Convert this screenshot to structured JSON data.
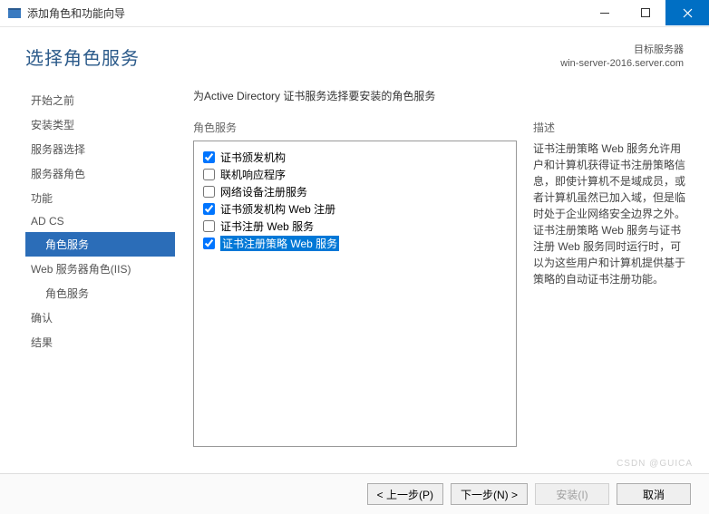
{
  "window": {
    "title": "添加角色和功能向导"
  },
  "header": {
    "heading": "选择角色服务",
    "target_label": "目标服务器",
    "target_value": "win-server-2016.server.com"
  },
  "sidebar": {
    "items": [
      {
        "label": "开始之前",
        "indent": false,
        "selected": false
      },
      {
        "label": "安装类型",
        "indent": false,
        "selected": false
      },
      {
        "label": "服务器选择",
        "indent": false,
        "selected": false
      },
      {
        "label": "服务器角色",
        "indent": false,
        "selected": false
      },
      {
        "label": "功能",
        "indent": false,
        "selected": false
      },
      {
        "label": "AD CS",
        "indent": false,
        "selected": false
      },
      {
        "label": "角色服务",
        "indent": true,
        "selected": true
      },
      {
        "label": "Web 服务器角色(IIS)",
        "indent": false,
        "selected": false
      },
      {
        "label": "角色服务",
        "indent": true,
        "selected": false
      },
      {
        "label": "确认",
        "indent": false,
        "selected": false
      },
      {
        "label": "结果",
        "indent": false,
        "selected": false
      }
    ]
  },
  "main": {
    "instruction": "为Active Directory 证书服务选择要安装的角色服务",
    "roles_label": "角色服务",
    "desc_label": "描述",
    "items": [
      {
        "label": "证书颁发机构",
        "checked": true,
        "highlighted": false
      },
      {
        "label": "联机响应程序",
        "checked": false,
        "highlighted": false
      },
      {
        "label": "网络设备注册服务",
        "checked": false,
        "highlighted": false
      },
      {
        "label": "证书颁发机构 Web 注册",
        "checked": true,
        "highlighted": false
      },
      {
        "label": "证书注册 Web 服务",
        "checked": false,
        "highlighted": false
      },
      {
        "label": "证书注册策略 Web 服务",
        "checked": true,
        "highlighted": true
      }
    ],
    "description": "证书注册策略 Web 服务允许用户和计算机获得证书注册策略信息，即使计算机不是域成员，或者计算机虽然已加入域，但是临时处于企业网络安全边界之外。证书注册策略 Web 服务与证书注册 Web 服务同时运行时，可以为这些用户和计算机提供基于策略的自动证书注册功能。"
  },
  "footer": {
    "prev": "< 上一步(P)",
    "next": "下一步(N) >",
    "install": "安装(I)",
    "cancel": "取消"
  },
  "watermark": "CSDN @GUICA"
}
